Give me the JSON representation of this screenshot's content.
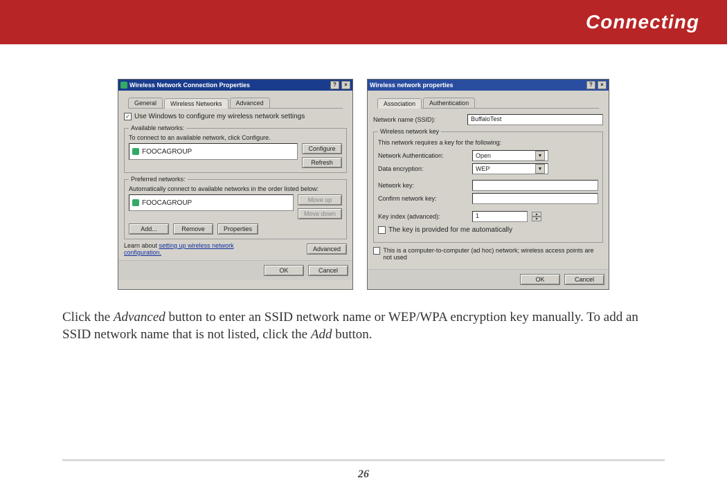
{
  "header": {
    "title": "Connecting"
  },
  "left_dialog": {
    "title": "Wireless Network Connection Properties",
    "tabs": [
      "General",
      "Wireless Networks",
      "Advanced"
    ],
    "active_tab": 1,
    "use_windows_label": "Use Windows to configure my wireless network settings",
    "available": {
      "legend": "Available networks:",
      "hint": "To connect to an available network, click Configure.",
      "item": "FOOCAGROUP",
      "btn_configure": "Configure",
      "btn_refresh": "Refresh"
    },
    "preferred": {
      "legend": "Preferred networks:",
      "hint": "Automatically connect to available networks in the order listed below:",
      "item": "FOOCAGROUP",
      "btn_move_up": "Move up",
      "btn_move_down": "Move down",
      "btn_add": "Add...",
      "btn_remove": "Remove",
      "btn_props": "Properties"
    },
    "learn_text": "Learn about ",
    "learn_link": "setting up wireless network configuration.",
    "btn_advanced": "Advanced",
    "btn_ok": "OK",
    "btn_cancel": "Cancel"
  },
  "right_dialog": {
    "title": "Wireless network properties",
    "tabs": [
      "Association",
      "Authentication"
    ],
    "active_tab": 0,
    "ssid_label": "Network name (SSID):",
    "ssid_value": "BuffaloTest",
    "key_legend": "Wireless network key",
    "key_hint": "This network requires a key for the following:",
    "auth_label": "Network Authentication:",
    "auth_value": "Open",
    "enc_label": "Data encryption:",
    "enc_value": "WEP",
    "netkey_label": "Network key:",
    "confirm_label": "Confirm network key:",
    "keyindex_label": "Key index (advanced):",
    "keyindex_value": "1",
    "autokey_label": "The key is provided for me automatically",
    "adhoc_label": "This is a computer-to-computer (ad hoc) network; wireless access points are not used",
    "btn_ok": "OK",
    "btn_cancel": "Cancel"
  },
  "caption": {
    "pre": "Click the ",
    "em1": "Advanced",
    "mid": " button to enter an SSID network name or WEP/WPA encryption key manually.  To add an SSID network name that is not listed, click the ",
    "em2": "Add",
    "post": " button."
  },
  "page_number": "26"
}
